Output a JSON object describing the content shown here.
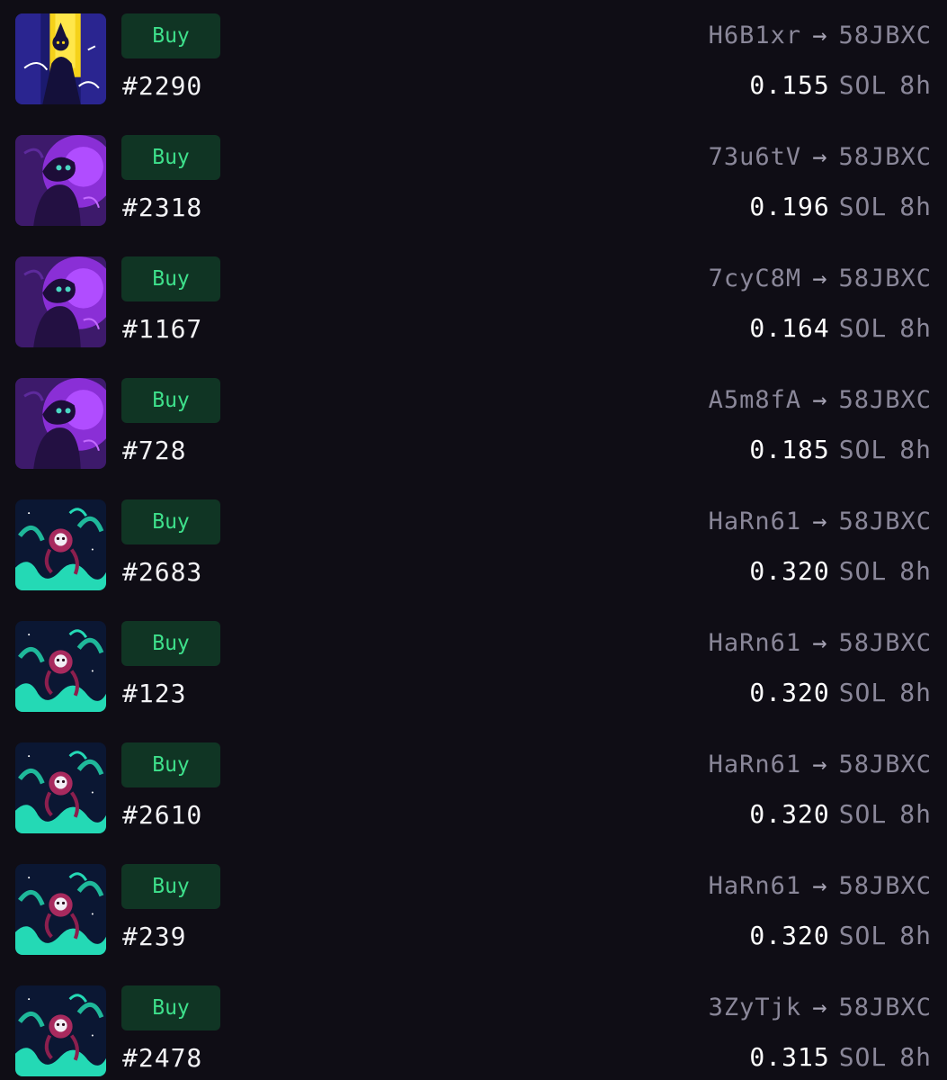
{
  "colors": {
    "background": "#0f0d15",
    "buy_bg": "#103524",
    "buy_text": "#3ee08b",
    "muted": "#8a8799",
    "text": "#f2f2f5"
  },
  "items": [
    {
      "buy_label": "Buy",
      "token": "#2290",
      "from": "H6B1xr",
      "arrow": "→",
      "to": "58JBXC",
      "price": "0.155",
      "currency": "SOL",
      "age": "8h",
      "art": "yellow-portal"
    },
    {
      "buy_label": "Buy",
      "token": "#2318",
      "from": "73u6tV",
      "arrow": "→",
      "to": "58JBXC",
      "price": "0.196",
      "currency": "SOL",
      "age": "8h",
      "art": "purple-smoke"
    },
    {
      "buy_label": "Buy",
      "token": "#1167",
      "from": "7cyC8M",
      "arrow": "→",
      "to": "58JBXC",
      "price": "0.164",
      "currency": "SOL",
      "age": "8h",
      "art": "purple-smoke"
    },
    {
      "buy_label": "Buy",
      "token": "#728",
      "from": "A5m8fA",
      "arrow": "→",
      "to": "58JBXC",
      "price": "0.185",
      "currency": "SOL",
      "age": "8h",
      "art": "purple-smoke"
    },
    {
      "buy_label": "Buy",
      "token": "#2683",
      "from": "HaRn61",
      "arrow": "→",
      "to": "58JBXC",
      "price": "0.320",
      "currency": "SOL",
      "age": "8h",
      "art": "teal-skull"
    },
    {
      "buy_label": "Buy",
      "token": "#123",
      "from": "HaRn61",
      "arrow": "→",
      "to": "58JBXC",
      "price": "0.320",
      "currency": "SOL",
      "age": "8h",
      "art": "teal-skull"
    },
    {
      "buy_label": "Buy",
      "token": "#2610",
      "from": "HaRn61",
      "arrow": "→",
      "to": "58JBXC",
      "price": "0.320",
      "currency": "SOL",
      "age": "8h",
      "art": "teal-skull"
    },
    {
      "buy_label": "Buy",
      "token": "#239",
      "from": "HaRn61",
      "arrow": "→",
      "to": "58JBXC",
      "price": "0.320",
      "currency": "SOL",
      "age": "8h",
      "art": "teal-skull"
    },
    {
      "buy_label": "Buy",
      "token": "#2478",
      "from": "3ZyTjk",
      "arrow": "→",
      "to": "58JBXC",
      "price": "0.315",
      "currency": "SOL",
      "age": "8h",
      "art": "teal-skull"
    }
  ]
}
